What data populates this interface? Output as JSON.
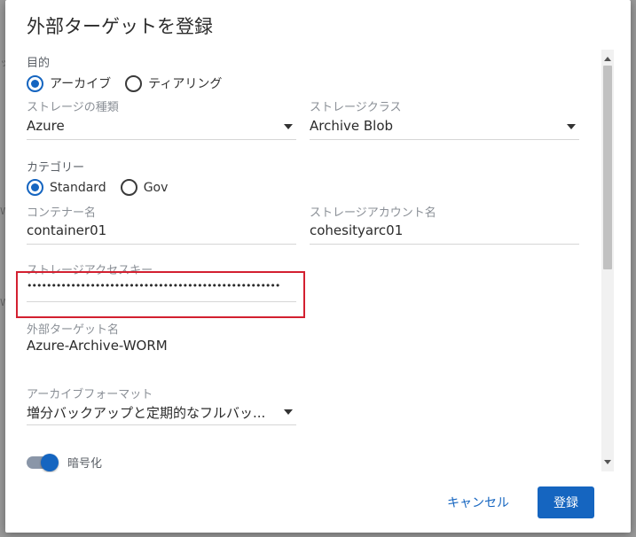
{
  "dialog": {
    "title": "外部ターゲットを登録"
  },
  "purpose": {
    "label": "目的",
    "options": [
      "アーカイブ",
      "ティアリング"
    ],
    "selected": "アーカイブ"
  },
  "storage_type": {
    "label": "ストレージの種類",
    "value": "Azure"
  },
  "storage_class": {
    "label": "ストレージクラス",
    "value": "Archive Blob"
  },
  "category": {
    "label": "カテゴリー",
    "options": [
      "Standard",
      "Gov"
    ],
    "selected": "Standard"
  },
  "container_name": {
    "label": "コンテナー名",
    "value": "container01"
  },
  "storage_account": {
    "label": "ストレージアカウント名",
    "value": "cohesityarc01"
  },
  "access_key": {
    "label": "ストレージアクセスキー",
    "value": "••••••••••••••••••••••••••••••••••••••••••••••••••••"
  },
  "target_name": {
    "label": "外部ターゲット名",
    "value": "Azure-Archive-WORM"
  },
  "archive_format": {
    "label": "アーカイブフォーマット",
    "value": "増分バックアップと定期的なフルバッ..."
  },
  "encryption": {
    "label": "暗号化",
    "enabled": true
  },
  "buttons": {
    "cancel": "キャンセル",
    "submit": "登録"
  },
  "colors": {
    "accent": "#1565c0",
    "highlight": "#d32030"
  }
}
